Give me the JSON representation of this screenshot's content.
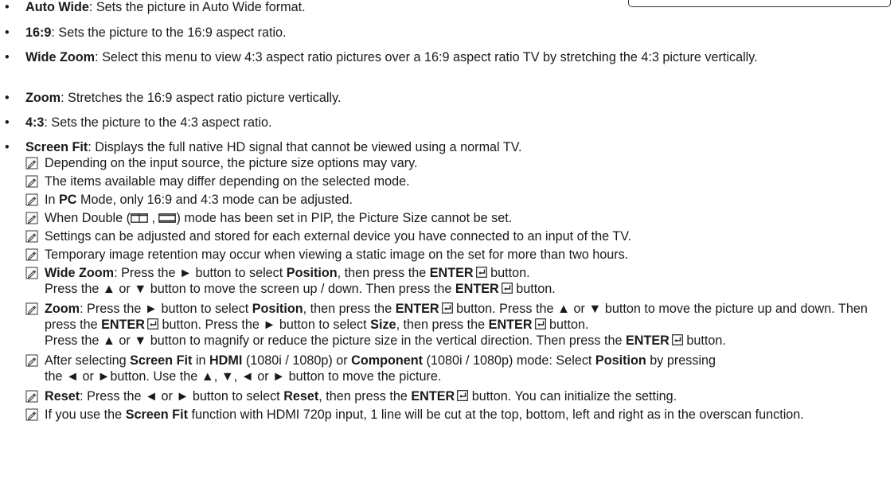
{
  "bullets": [
    {
      "term": "Auto Wide",
      "text": ": Sets the picture in Auto Wide format."
    },
    {
      "term": "16:9",
      "text": ": Sets the picture to the 16:9 aspect ratio."
    },
    {
      "term": "Wide Zoom",
      "text": ": Select this menu to view 4:3 aspect ratio pictures over a 16:9 aspect ratio TV by stretching the 4:3 picture vertically."
    },
    {
      "term": "Zoom",
      "text": ": Stretches the 16:9 aspect ratio picture vertically."
    },
    {
      "term": "4:3",
      "text": ": Sets the picture to the 4:3 aspect ratio."
    },
    {
      "term": "Screen Fit",
      "text": ": Displays the full native HD signal that cannot be viewed using a normal TV."
    }
  ],
  "notes": {
    "n1": "Depending on the input source, the picture size options may vary.",
    "n2": "The items available may differ depending on the selected mode.",
    "n3": {
      "a": "In ",
      "b": "PC",
      "c": " Mode, only 16:9 and 4:3 mode can be adjusted."
    },
    "n4": {
      "a": "When Double (",
      "sep": " , ",
      "b": ") mode has been set in PIP, the Picture Size cannot be set."
    },
    "n5": "Settings can be adjusted and stored for each external device you have connected to an input of the TV.",
    "n6": "Temporary image retention may occur when viewing a static image on the set for more than two hours.",
    "n7": {
      "t1": "Wide Zoom",
      "t2": ": Press the ► button to select ",
      "t3": "Position",
      "t4": ", then press the ",
      "t5": "ENTER",
      "t6": " button.",
      "t7": "Press the ▲ or ▼ button to move the screen up / down. Then press the ",
      "t8": "ENTER",
      "t9": " button."
    },
    "n8": {
      "t1": "Zoom",
      "t2": ": Press the ► button to select ",
      "t3": "Position",
      "t4": ", then press the ",
      "t5": "ENTER",
      "t6": " button. Press the ▲ or ▼ button to move the picture up and down. Then press the ",
      "t7": "ENTER",
      "t8": " button. Press the ► button to select ",
      "t9": "Size",
      "t10": ", then press the ",
      "t11": "ENTER",
      "t12": " button.",
      "t13": "Press the ▲ or ▼ button to magnify or reduce the picture size in the vertical direction. Then press the ",
      "t14": "ENTER",
      "t15": " button."
    },
    "n9": {
      "t1": "After selecting ",
      "t2": "Screen Fit",
      "t3": " in ",
      "t4": "HDMI",
      "t5": " (1080i / 1080p) or ",
      "t6": "Component",
      "t7": " (1080i / 1080p) mode: Select ",
      "t8": "Position",
      "t9": " by pressing",
      "t10": "the ◄ or ►button. Use the ▲, ▼, ◄ or ► button to move the picture."
    },
    "n10": {
      "t1": "Reset",
      "t2": ": Press the ◄ or ► button to select ",
      "t3": "Reset",
      "t4": ", then press the ",
      "t5": "ENTER",
      "t6": " button. You can initialize the setting."
    },
    "n11": {
      "t1": "If you use the ",
      "t2": "Screen Fit",
      "t3": " function with HDMI 720p input, 1 line will be cut at the top, bottom, left and right as in the overscan function."
    }
  }
}
